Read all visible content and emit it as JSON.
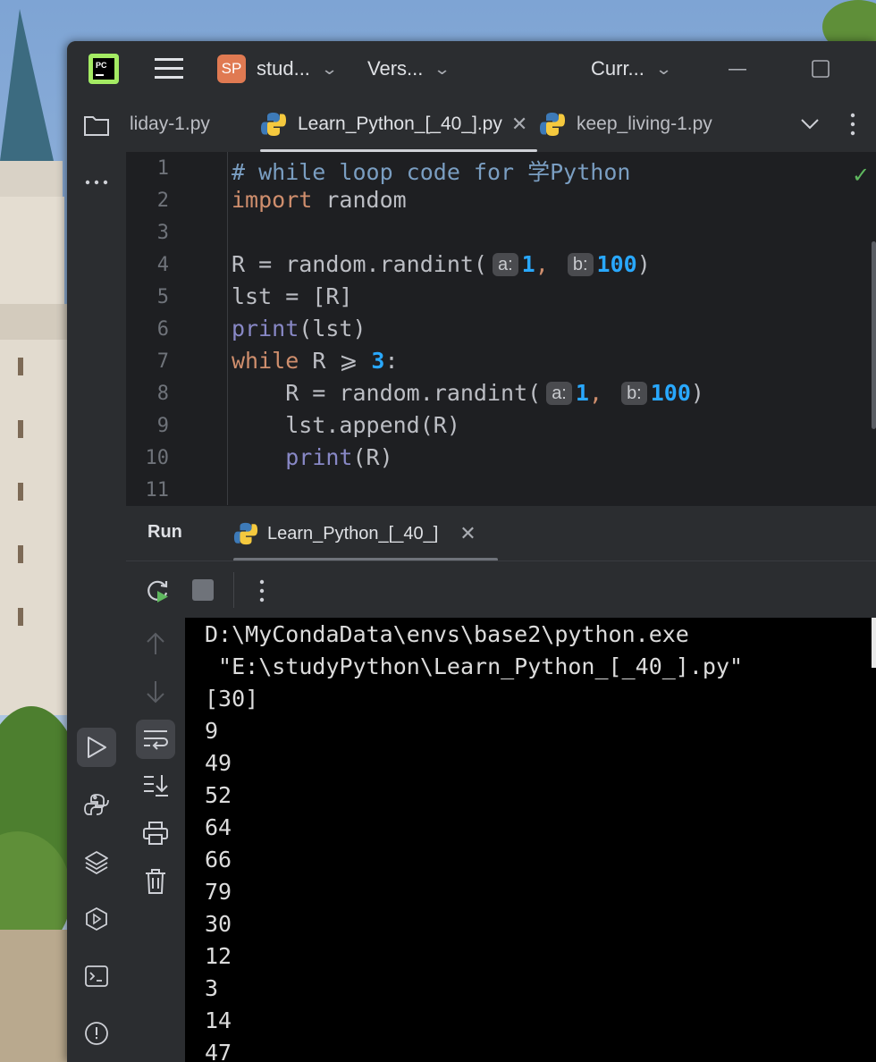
{
  "colors": {
    "window_bg": "#2b2d30",
    "editor_bg": "#1e1f22",
    "console_bg": "#000000",
    "keyword": "#cf8e6d",
    "comment": "#7a9ec2",
    "number": "#29a8ff",
    "builtin": "#8888c6",
    "accent": "#3574f0"
  },
  "titlebar": {
    "app_icon": "pycharm-icon",
    "project_badge": "SP",
    "project_name": "stud...",
    "vcs_label": "Vers...",
    "run_config": "Curr..."
  },
  "tabs": [
    {
      "label": "liday-1.py",
      "active": false
    },
    {
      "label": "Learn_Python_[_40_].py",
      "active": true
    },
    {
      "label": "keep_living-1.py",
      "active": false
    }
  ],
  "editor": {
    "line_numbers": [
      "1",
      "2",
      "3",
      "4",
      "5",
      "6",
      "7",
      "8",
      "9",
      "10",
      "11"
    ],
    "lines": {
      "l1_comment": "# while loop code for 学Python",
      "l2_kw": "import",
      "l2_rest": " random",
      "l4_pre": "R = random.randint(",
      "hint_a": "a:",
      "hint_b": "b:",
      "num_1": "1",
      "num_100": "100",
      "comma": ",",
      "paren_close": ")",
      "l5": "lst = [R]",
      "print_kw": "print",
      "l6_rest": "(lst)",
      "while_kw": "while",
      "l7_mid": " R ⩾ ",
      "num_3": "3",
      "colon": ":",
      "l8_pre": "    R = random.randint(",
      "l9": "    lst.append(R)",
      "indent": "    ",
      "l10_rest": "(R)"
    }
  },
  "run_panel": {
    "title": "Run",
    "tab_label": "Learn_Python_[_40_]"
  },
  "console": {
    "lines": [
      "D:\\MyCondaData\\envs\\base2\\python.exe",
      " \"E:\\studyPython\\Learn_Python_[_40_].py\"",
      "[30]",
      "9",
      "49",
      "52",
      "64",
      "66",
      "79",
      "30",
      "12",
      "3",
      "14",
      "47"
    ]
  }
}
